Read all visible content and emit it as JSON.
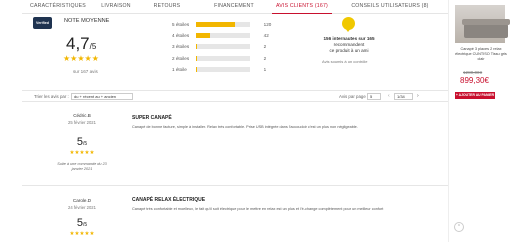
{
  "tabs": [
    {
      "label": "CARACTÉRISTIQUES"
    },
    {
      "label": "LIVRAISON"
    },
    {
      "label": "RETOURS"
    },
    {
      "label": "FINANCEMENT"
    },
    {
      "label": "AVIS CLIENTS (167)"
    },
    {
      "label": "CONSEILS UTILISATEURS (8)"
    }
  ],
  "summary": {
    "logo_text": "Verified",
    "note_label": "NOTE MOYENNE",
    "score": "4,7",
    "score_suffix": "/5",
    "stars": "★★★★★",
    "avis_count": "sur 167 avis"
  },
  "distribution": [
    {
      "label": "5 étoiles",
      "count": "120",
      "fraction": 0.72
    },
    {
      "label": "4 étoiles",
      "count": "42",
      "fraction": 0.25
    },
    {
      "label": "3 étoiles",
      "count": "2",
      "fraction": 0.015
    },
    {
      "label": "2 étoiles",
      "count": "2",
      "fraction": 0.015
    },
    {
      "label": "1 étoile",
      "count": "1",
      "fraction": 0.008
    }
  ],
  "recommend": {
    "line1": "156 internautes sur 165",
    "line2": "recommandent",
    "line3": "ce produit à un ami",
    "link": "Avis soumis à un contrôle"
  },
  "toolbar": {
    "sort_label": "Trier les avis par :",
    "sort_value": "du + récent au + ancien",
    "per_page_label": "Avis par page :",
    "per_page_value": "5",
    "page_value": "1/34",
    "prev": "‹",
    "next": "›"
  },
  "reviews": [
    {
      "author": "Cédric.B",
      "date": "25 février 2021",
      "score": "5",
      "score_suffix": "/5",
      "stars": "★★★★★",
      "note": "Suite à une commande du 23 janvier 2021",
      "title": "SUPER CANAPÉ",
      "body": "Canapé de bonne facture, simple à installer. Relax très confortable. Prise USB intégrée dans l'accoudoir c'est un plus non négligeable."
    },
    {
      "author": "Carole.D",
      "date": "24 février 2021",
      "score": "5",
      "score_suffix": "/5",
      "stars": "★★★★★",
      "title": "CANAPÉ RELAX ÉLECTRIQUE",
      "body": "Canapé très confortable et moelleux, le fait qu'il soit électrique pour le mettre en relax est un plus et l'é-change complètement pour un meilleur confort"
    }
  ],
  "product": {
    "name": "Canapé 3 places 2 relax électrique CUNTISO Tissu gris clair",
    "old_price": "1280,00€",
    "new_price": "899,30€",
    "button": "+ AJOUTER AU PANIER"
  },
  "colors": {
    "accent": "#c8102e",
    "star": "#f2b600"
  }
}
